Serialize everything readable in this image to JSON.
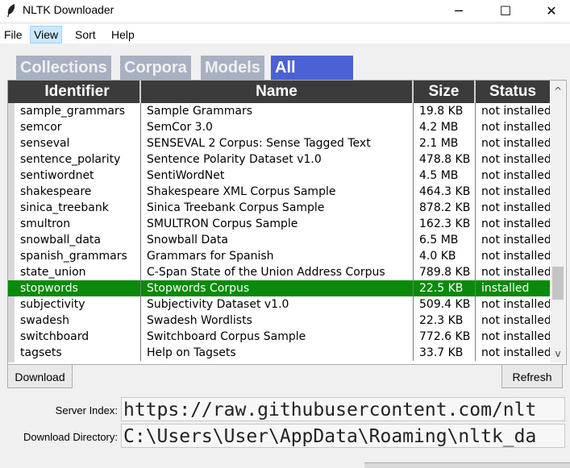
{
  "window": {
    "title": "NLTK Downloader",
    "controls": {
      "minimize": "─",
      "maximize": "☐",
      "close": "✕"
    }
  },
  "menu": [
    "File",
    "View",
    "Sort",
    "Help"
  ],
  "tabs": [
    "Collections",
    "Corpora",
    "Models",
    "All Packages"
  ],
  "table": {
    "headers": [
      "Identifier",
      "Name",
      "Size",
      "Status"
    ],
    "rows": [
      [
        "sample_grammars",
        "Sample Grammars",
        "19.8 KB",
        "not installed"
      ],
      [
        "semcor",
        "SemCor 3.0",
        "4.2 MB",
        "not installed"
      ],
      [
        "senseval",
        "SENSEVAL 2 Corpus: Sense Tagged Text",
        "2.1 MB",
        "not installed"
      ],
      [
        "sentence_polarity",
        "Sentence Polarity Dataset v1.0",
        "478.8 KB",
        "not installed"
      ],
      [
        "sentiwordnet",
        "SentiWordNet",
        "4.5 MB",
        "not installed"
      ],
      [
        "shakespeare",
        "Shakespeare XML Corpus Sample",
        "464.3 KB",
        "not installed"
      ],
      [
        "sinica_treebank",
        "Sinica Treebank Corpus Sample",
        "878.2 KB",
        "not installed"
      ],
      [
        "smultron",
        "SMULTRON Corpus Sample",
        "162.3 KB",
        "not installed"
      ],
      [
        "snowball_data",
        "Snowball Data",
        "6.5 MB",
        "not installed"
      ],
      [
        "spanish_grammars",
        "Grammars for Spanish",
        "4.0 KB",
        "not installed"
      ],
      [
        "state_union",
        "C-Span State of the Union Address Corpus",
        "789.8 KB",
        "not installed"
      ],
      [
        "stopwords",
        "Stopwords Corpus",
        "22.5 KB",
        "installed"
      ],
      [
        "subjectivity",
        "Subjectivity Dataset v1.0",
        "509.4 KB",
        "not installed"
      ],
      [
        "swadesh",
        "Swadesh Wordlists",
        "22.3 KB",
        "not installed"
      ],
      [
        "switchboard",
        "Switchboard Corpus Sample",
        "772.6 KB",
        "not installed"
      ],
      [
        "tagsets",
        "Help on Tagsets",
        "33.7 KB",
        "not installed"
      ]
    ]
  },
  "buttons": {
    "download": "Download",
    "refresh": "Refresh"
  },
  "fields": {
    "server_index_label": "Server Index:",
    "server_index_value": "https://raw.githubusercontent.com/nlt",
    "download_dir_label": "Download Directory:",
    "download_dir_value": "C:\\Users\\User\\AppData\\Roaming\\nltk_da"
  },
  "colors": {
    "selected_row": "#0a8a0a",
    "active_tab": "#4a62d6",
    "inactive_tab": "#a8b0c2",
    "header": "#3b3b3b"
  }
}
